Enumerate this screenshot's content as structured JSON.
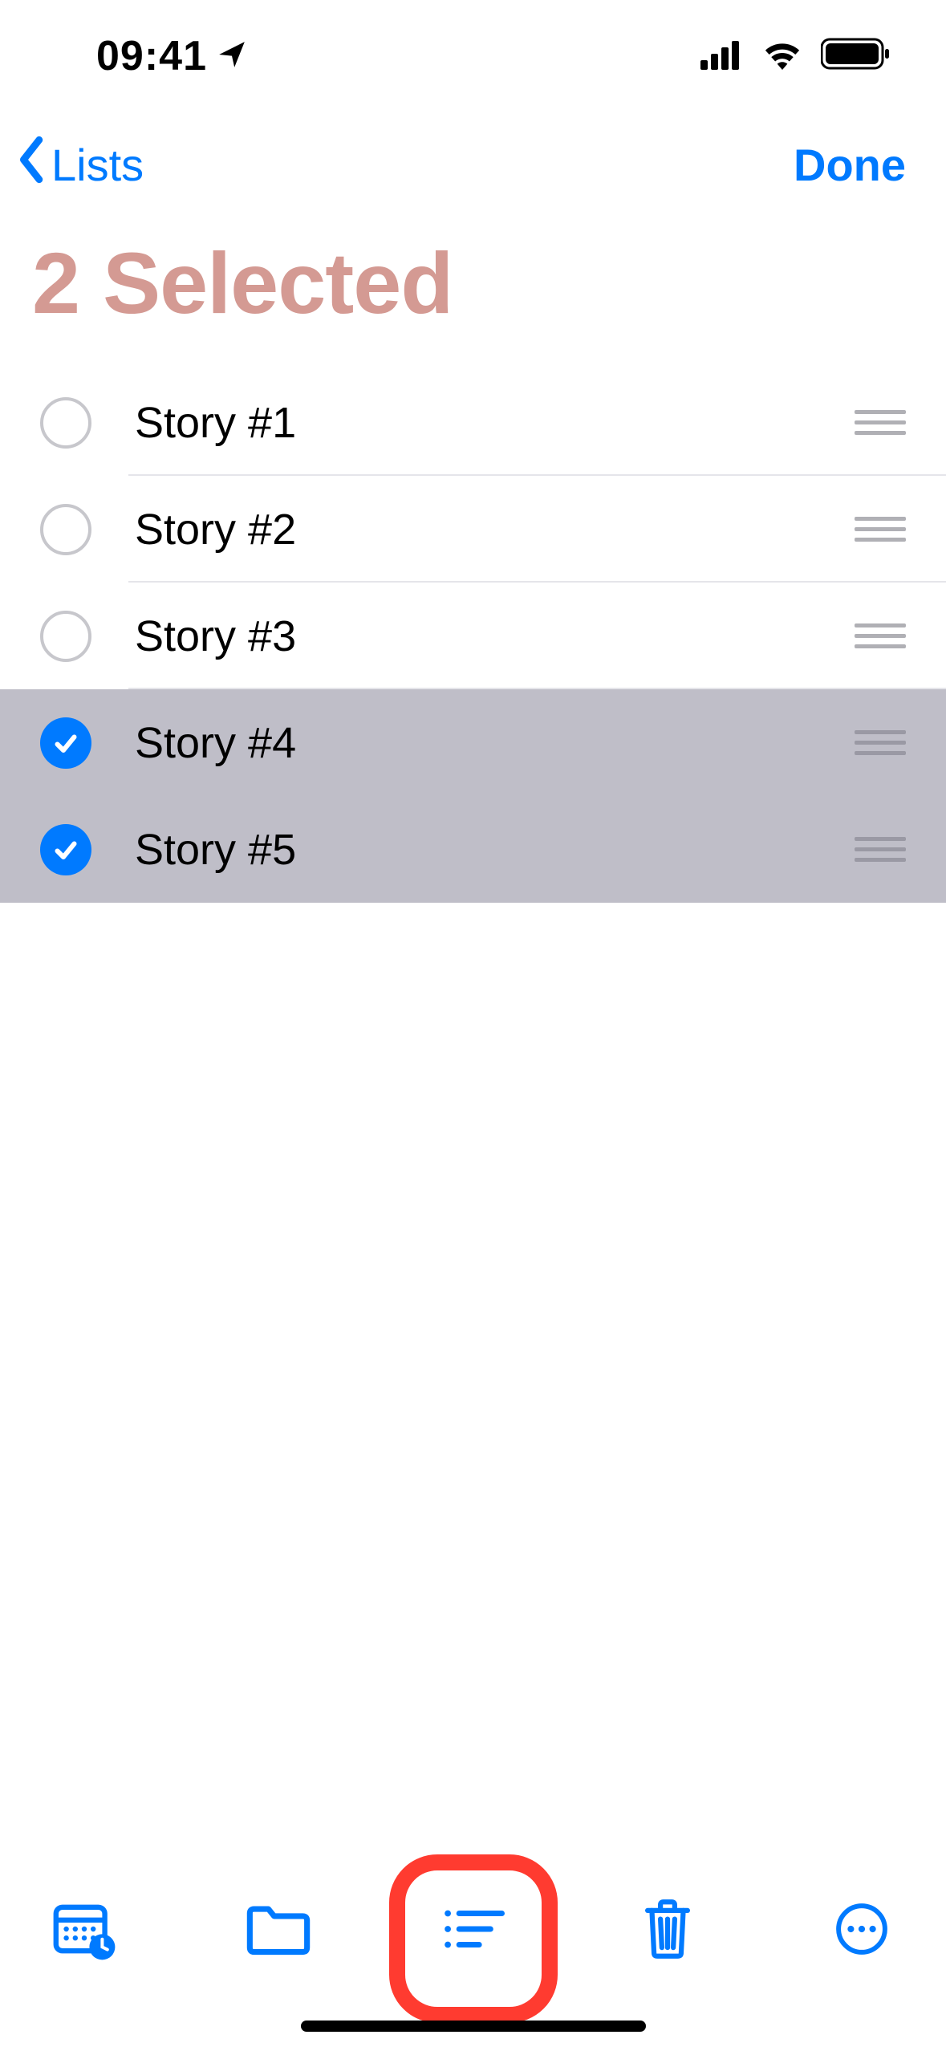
{
  "status": {
    "time": "09:41"
  },
  "nav": {
    "back_label": "Lists",
    "done_label": "Done"
  },
  "title": "2 Selected",
  "items": [
    {
      "label": "Story #1",
      "selected": false
    },
    {
      "label": "Story #2",
      "selected": false
    },
    {
      "label": "Story #3",
      "selected": false
    },
    {
      "label": "Story #4",
      "selected": true
    },
    {
      "label": "Story #5",
      "selected": true
    }
  ],
  "colors": {
    "accent": "#007aff",
    "title_tint": "#d49a93",
    "selected_bg": "#bfbec8",
    "highlight": "#ff3b30"
  }
}
